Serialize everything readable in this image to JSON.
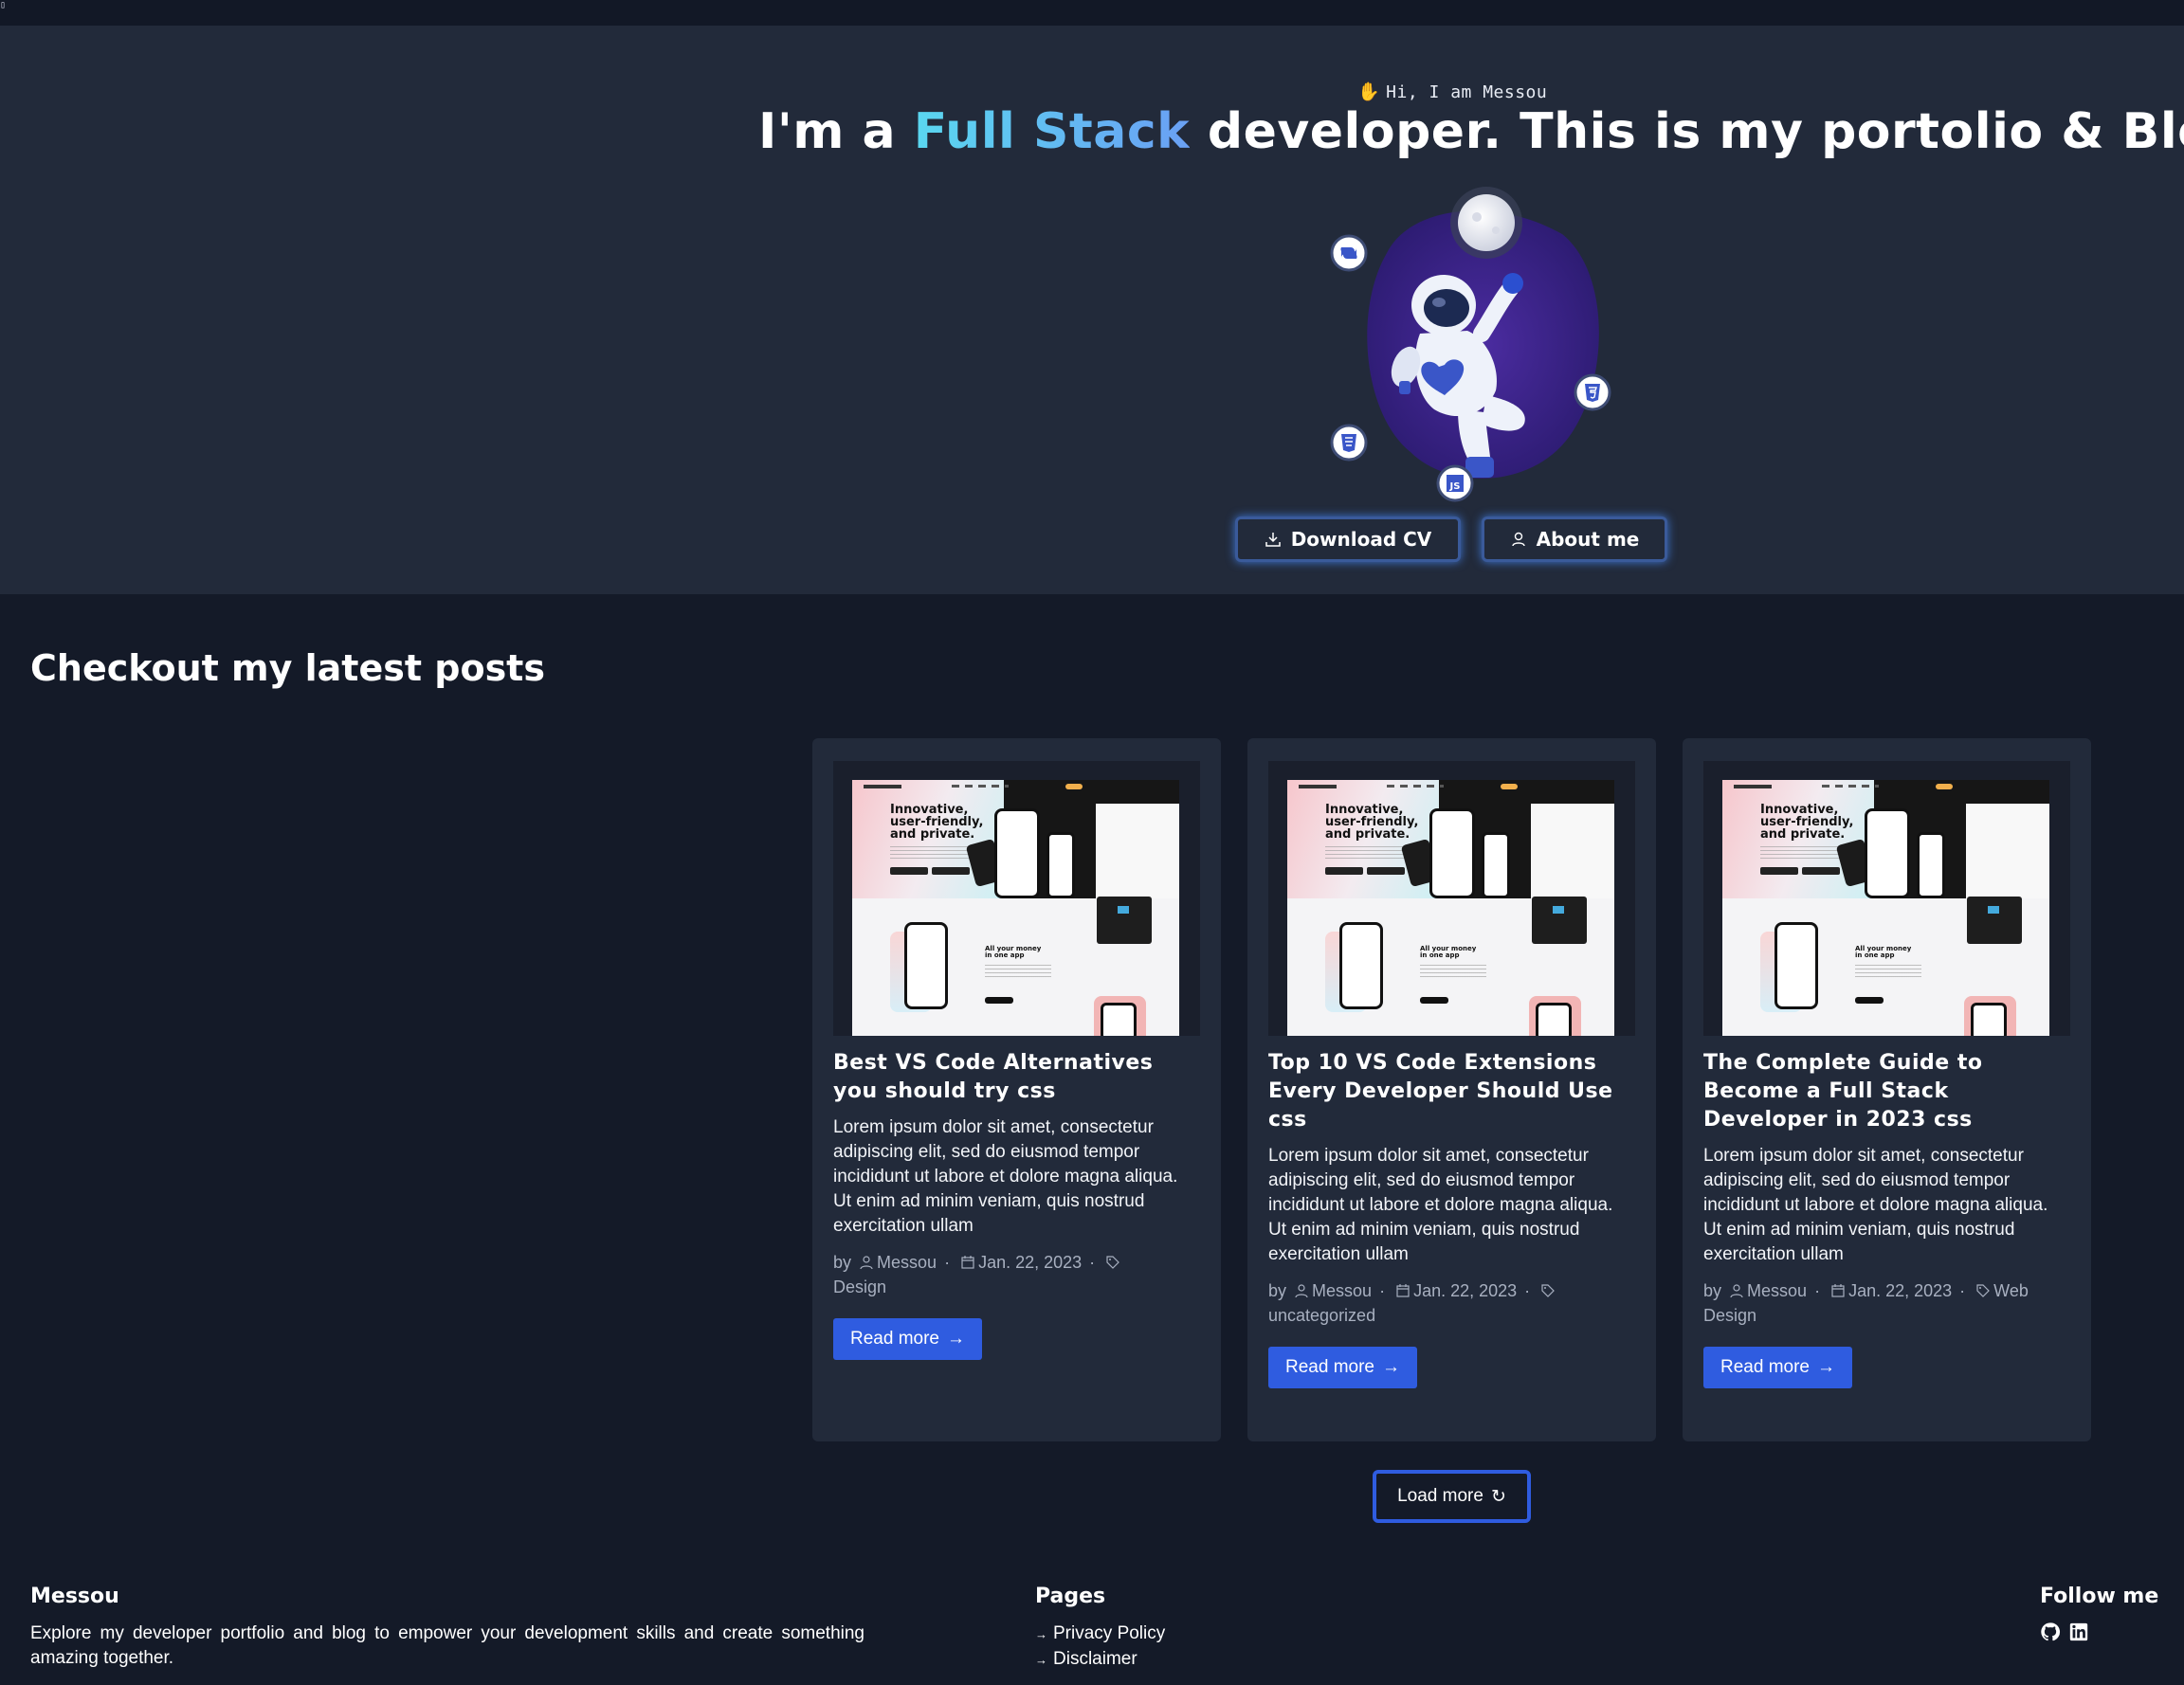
{
  "hero": {
    "greeting": "Hi, I am Messou",
    "wave_icon": "waving-hand",
    "headline_pre": "I'm a ",
    "headline_accent": "Full Stack",
    "headline_post": " developer. This is my portolio & Blog.",
    "buttons": {
      "cv": "Download CV",
      "about": "About me"
    },
    "illustration_icons": [
      "python-icon",
      "html5-icon",
      "css3-icon",
      "javascript-icon"
    ]
  },
  "posts": {
    "section_title": "Checkout my latest posts",
    "items": [
      {
        "title": "Best VS Code Alternatives you should try css",
        "excerpt": "Lorem ipsum dolor sit amet, consectetur adipiscing elit, sed do eiusmod tempor incididunt ut labore et dolore magna aliqua. Ut enim ad minim veniam, quis nostrud exercitation ullam",
        "by": "by",
        "author": "Messou",
        "date": "Jan. 22, 2023",
        "category": "Design",
        "read_more": "Read more"
      },
      {
        "title": "Top 10 VS Code Extensions Every Developer Should Use css",
        "excerpt": "Lorem ipsum dolor sit amet, consectetur adipiscing elit, sed do eiusmod tempor incididunt ut labore et dolore magna aliqua. Ut enim ad minim veniam, quis nostrud exercitation ullam",
        "by": "by",
        "author": "Messou",
        "date": "Jan. 22, 2023",
        "category": "uncategorized",
        "read_more": "Read more"
      },
      {
        "title": "The Complete Guide to Become a Full Stack Developer in 2023 css",
        "excerpt": "Lorem ipsum dolor sit amet, consectetur adipiscing elit, sed do eiusmod tempor incididunt ut labore et dolore magna aliqua. Ut enim ad minim veniam, quis nostrud exercitation ullam",
        "by": "by",
        "author": "Messou",
        "date": "Jan. 22, 2023",
        "category": "Web Design",
        "read_more": "Read more"
      }
    ],
    "thumbnail_text": "Innovative, user-friendly, and private.",
    "thumbnail_text2": "All your money in one app",
    "load_more": "Load more"
  },
  "footer": {
    "brand": "Messou",
    "tagline": "Explore my developer portfolio and blog to empower your development skills and create something amazing together.",
    "pages_title": "Pages",
    "pages": [
      "Privacy Policy",
      "Disclaimer"
    ],
    "follow_title": "Follow me",
    "social_icons": [
      "github-icon",
      "linkedin-icon"
    ]
  },
  "colors": {
    "background": "#141a28",
    "hero_background": "#222a3a",
    "card_background": "#222a3a",
    "accent_blue": "#2f5ce0",
    "accent_cyan": "#5ad7f0"
  }
}
